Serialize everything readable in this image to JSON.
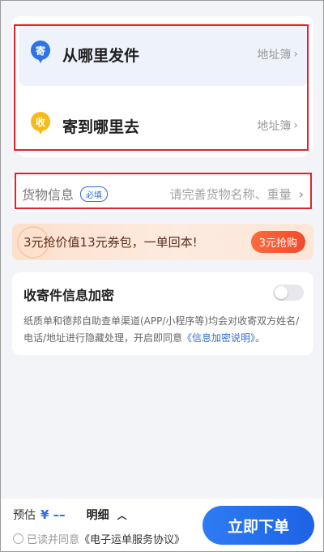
{
  "address": {
    "sender_badge": "寄",
    "sender_title": "从哪里发件",
    "sender_link": "地址簿",
    "receiver_badge": "收",
    "receiver_title": "寄到哪里去",
    "receiver_link": "地址簿",
    "chevron": "›"
  },
  "cargo": {
    "label": "货物信息",
    "required": "必填",
    "hint": "请完善货物名称、重量",
    "chevron": "›"
  },
  "promo": {
    "text": "3元抢价值13元券包，一单回本!",
    "button": "3元抢购"
  },
  "encrypt": {
    "title": "收寄件信息加密",
    "toggle_on": false,
    "desc_prefix": "纸质单和德邦自助查单渠道(APP/小程序等)均会对收寄双方姓名/电话/地址进行隐藏处理，开启即同意",
    "desc_link": "《信息加密说明》",
    "desc_suffix": "。"
  },
  "bottom": {
    "estimate_label": "预估",
    "estimate_amount": "¥ ––",
    "detail_label": "明细",
    "detail_icon": "chevron-up-icon",
    "agree_prefix": "已读并同意",
    "agree_link": "《电子运单服务协议》",
    "submit": "立即下单"
  },
  "colors": {
    "accent_blue": "#2f74e6",
    "receiver_yellow": "#f5bb1c",
    "highlight_red": "#e8202a",
    "promo_orange": "#f14b2e"
  }
}
